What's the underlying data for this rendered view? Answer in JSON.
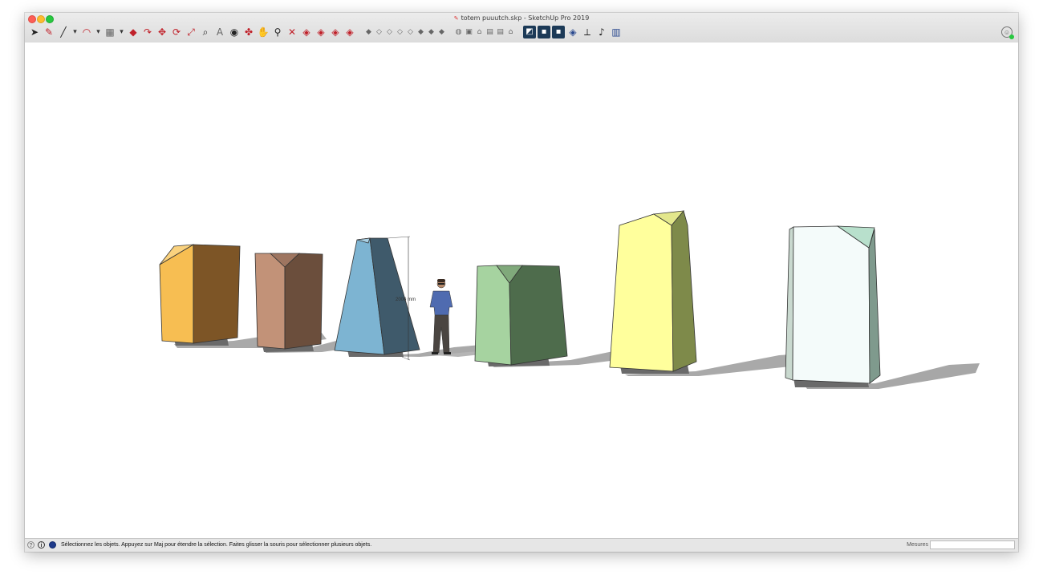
{
  "window": {
    "title": "totem puuutch.skp - SketchUp Pro 2019"
  },
  "toolbar": {
    "tools": [
      {
        "name": "select-tool-icon",
        "glyph": "➤",
        "style": "dk"
      },
      {
        "name": "eraser-tool-icon",
        "glyph": "✎",
        "style": "red"
      },
      {
        "name": "line-tool-icon",
        "glyph": "╱",
        "style": "dk"
      },
      {
        "name": "line-tool-dropdown-icon",
        "glyph": "▾",
        "style": "small"
      },
      {
        "name": "arc-tool-icon",
        "glyph": "◠",
        "style": "red"
      },
      {
        "name": "arc-tool-dropdown-icon",
        "glyph": "▾",
        "style": "small"
      },
      {
        "name": "rectangle-tool-icon",
        "glyph": "▦",
        "style": "gray"
      },
      {
        "name": "rectangle-tool-dropdown-icon",
        "glyph": "▾",
        "style": "small"
      },
      {
        "name": "push-pull-tool-icon",
        "glyph": "◆",
        "style": "red"
      },
      {
        "name": "follow-me-tool-icon",
        "glyph": "↷",
        "style": "red"
      },
      {
        "name": "move-tool-icon",
        "glyph": "✥",
        "style": "red"
      },
      {
        "name": "rotate-tool-icon",
        "glyph": "⟳",
        "style": "red"
      },
      {
        "name": "scale-tool-icon",
        "glyph": "⤢",
        "style": "red"
      },
      {
        "name": "tape-measure-tool-icon",
        "glyph": "⌕",
        "style": "dk"
      },
      {
        "name": "text-tool-icon",
        "glyph": "A",
        "style": "gray"
      },
      {
        "name": "paint-bucket-tool-icon",
        "glyph": "◉",
        "style": "dk"
      },
      {
        "name": "orbit-tool-icon",
        "glyph": "✤",
        "style": "red"
      },
      {
        "name": "pan-tool-icon",
        "glyph": "✋",
        "style": "dk"
      },
      {
        "name": "zoom-tool-icon",
        "glyph": "⚲",
        "style": "dk"
      },
      {
        "name": "zoom-extents-tool-icon",
        "glyph": "✕",
        "style": "red"
      },
      {
        "name": "warehouse-icon",
        "glyph": "◈",
        "style": "red"
      },
      {
        "name": "share-model-icon",
        "glyph": "◈",
        "style": "red"
      },
      {
        "name": "extension-warehouse-icon",
        "glyph": "◈",
        "style": "red"
      },
      {
        "name": "layout-send-icon",
        "glyph": "◈",
        "style": "red"
      },
      {
        "name": "sep-1",
        "glyph": "",
        "style": "sep"
      },
      {
        "name": "view-iso-icon",
        "glyph": "◆",
        "style": "sm"
      },
      {
        "name": "view-top-icon",
        "glyph": "◇",
        "style": "sm"
      },
      {
        "name": "view-front-icon",
        "glyph": "◇",
        "style": "sm"
      },
      {
        "name": "view-right-icon",
        "glyph": "◇",
        "style": "sm"
      },
      {
        "name": "view-back-icon",
        "glyph": "◇",
        "style": "sm"
      },
      {
        "name": "view-left-icon",
        "glyph": "◆",
        "style": "sm"
      },
      {
        "name": "view-bottom-icon",
        "glyph": "◆",
        "style": "sm"
      },
      {
        "name": "view-perspective-icon",
        "glyph": "◆",
        "style": "sm"
      },
      {
        "name": "sep-2",
        "glyph": "",
        "style": "sep"
      },
      {
        "name": "xray-style-icon",
        "glyph": "◍",
        "style": "sm"
      },
      {
        "name": "wireframe-style-icon",
        "glyph": "▣",
        "style": "sm"
      },
      {
        "name": "hidden-line-style-icon",
        "glyph": "⌂",
        "style": "sm"
      },
      {
        "name": "shaded-style-icon",
        "glyph": "▤",
        "style": "sm"
      },
      {
        "name": "shaded-textures-style-icon",
        "glyph": "▤",
        "style": "sm"
      },
      {
        "name": "monochrome-style-icon",
        "glyph": "⌂",
        "style": "sm"
      },
      {
        "name": "sep-3",
        "glyph": "",
        "style": "sep"
      },
      {
        "name": "section-plane-icon",
        "glyph": "◩",
        "style": "dkbox"
      },
      {
        "name": "solid-tools-icon",
        "glyph": "▪",
        "style": "dkbox"
      },
      {
        "name": "sandbox-tools-icon",
        "glyph": "▪",
        "style": "dkbox"
      },
      {
        "name": "outer-shell-icon",
        "glyph": "◈",
        "style": "blue"
      },
      {
        "name": "axes-tool-icon",
        "glyph": "⟂",
        "style": "dk"
      },
      {
        "name": "component-icon",
        "glyph": "♪",
        "style": "dk"
      },
      {
        "name": "materials-icon",
        "glyph": "▥",
        "style": "blue"
      }
    ]
  },
  "viewport": {
    "dimension_label": "2000 mm"
  },
  "statusbar": {
    "help_icon": "?",
    "info_icon": "i",
    "message": "Sélectionnez les objets. Appuyez sur Maj pour étendre la sélection. Faites glisser la souris pour sélectionner plusieurs objets.",
    "measurements_label": "Mesures",
    "measurements_value": ""
  }
}
